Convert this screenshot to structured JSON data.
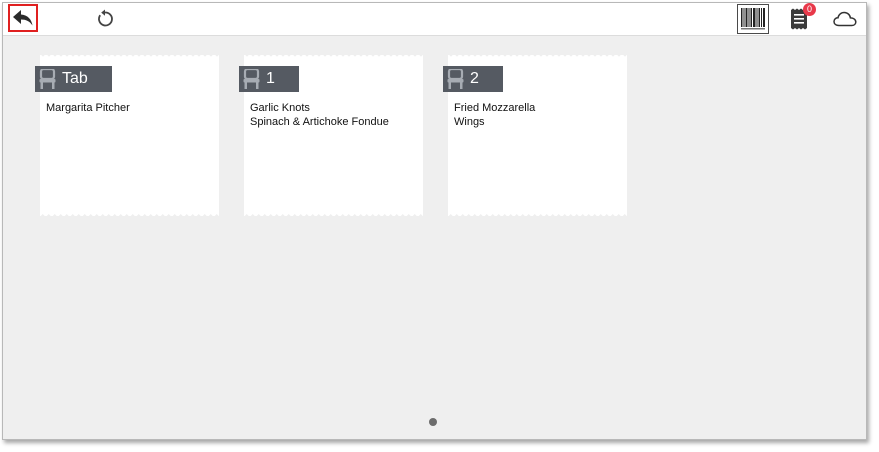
{
  "toolbar": {
    "notification_count": "0",
    "icons": {
      "back": "back-arrow-icon",
      "undo": "undo-icon",
      "barcode": "barcode-icon",
      "receipt": "receipt-icon",
      "cloud": "cloud-icon"
    }
  },
  "tickets": [
    {
      "seat": "Tab",
      "items": [
        "Margarita Pitcher"
      ]
    },
    {
      "seat": "1",
      "items": [
        "Garlic Knots",
        "Spinach & Artichoke Fondue"
      ]
    },
    {
      "seat": "2",
      "items": [
        "Fried Mozzarella",
        "Wings"
      ]
    }
  ],
  "pager": {
    "pages": 1,
    "current": 1
  },
  "colors": {
    "highlight": "#e02020",
    "badge": "#e8394a",
    "seat_tag": "#555a62",
    "background": "#efefef"
  }
}
